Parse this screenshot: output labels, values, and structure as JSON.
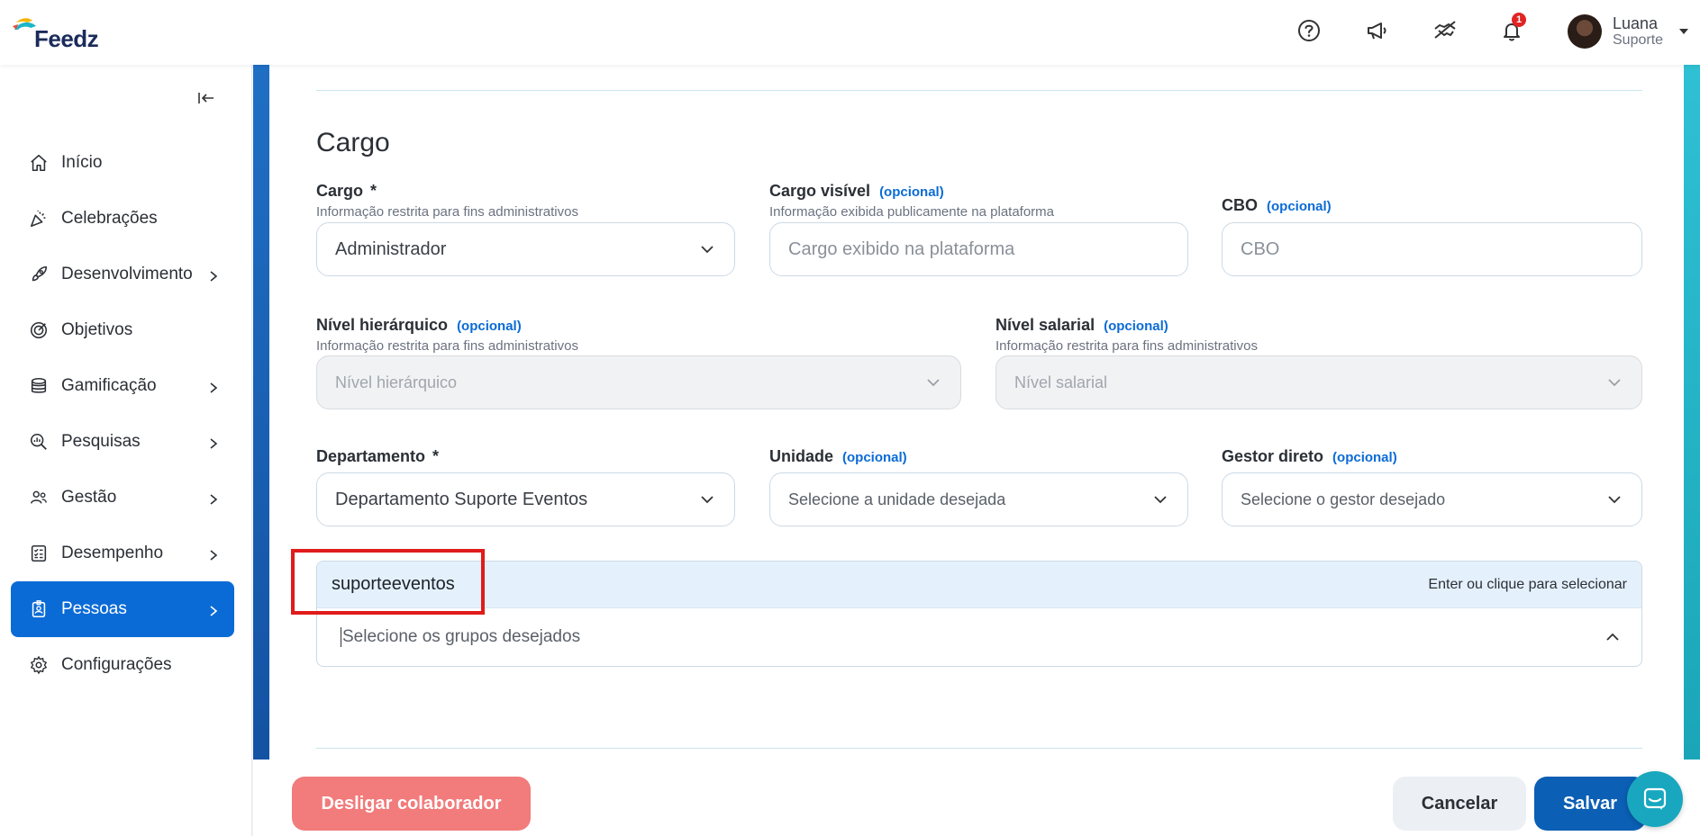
{
  "brand": {
    "name": "Feedz"
  },
  "header": {
    "icons": [
      "help-icon",
      "megaphone-icon",
      "handshake-icon",
      "bell-icon"
    ],
    "notification_count": "1",
    "user": {
      "name": "Luana",
      "role": "Suporte"
    }
  },
  "sidebar": {
    "items": [
      {
        "label": "Início",
        "icon": "home-icon",
        "has_children": false
      },
      {
        "label": "Celebrações",
        "icon": "party-icon",
        "has_children": false
      },
      {
        "label": "Desenvolvimento",
        "icon": "rocket-icon",
        "has_children": true
      },
      {
        "label": "Objetivos",
        "icon": "target-icon",
        "has_children": false
      },
      {
        "label": "Gamificação",
        "icon": "coins-icon",
        "has_children": true
      },
      {
        "label": "Pesquisas",
        "icon": "search-chart-icon",
        "has_children": true
      },
      {
        "label": "Gestão",
        "icon": "people-icon",
        "has_children": true
      },
      {
        "label": "Desempenho",
        "icon": "checklist-icon",
        "has_children": true
      },
      {
        "label": "Pessoas",
        "icon": "badge-icon",
        "has_children": true,
        "active": true
      },
      {
        "label": "Configurações",
        "icon": "gear-icon",
        "has_children": false
      }
    ]
  },
  "form": {
    "section_title": "Cargo",
    "optional_tag": "(opcional)",
    "cargo": {
      "label": "Cargo",
      "required": "*",
      "help": "Informação restrita para fins administrativos",
      "value": "Administrador"
    },
    "cargo_visivel": {
      "label": "Cargo visível",
      "help": "Informação exibida publicamente na plataforma",
      "placeholder": "Cargo exibido na plataforma"
    },
    "cbo": {
      "label": "CBO",
      "placeholder": "CBO"
    },
    "nivel_hierarquico": {
      "label": "Nível hierárquico",
      "help": "Informação restrita para fins administrativos",
      "placeholder": "Nível hierárquico"
    },
    "nivel_salarial": {
      "label": "Nível salarial",
      "help": "Informação restrita para fins administrativos",
      "placeholder": "Nível salarial"
    },
    "departamento": {
      "label": "Departamento",
      "required": "*",
      "value": "Departamento Suporte Eventos"
    },
    "unidade": {
      "label": "Unidade",
      "placeholder": "Selecione a unidade desejada"
    },
    "gestor": {
      "label": "Gestor direto",
      "placeholder": "Selecione o gestor desejado"
    },
    "grupos": {
      "option": "suporteeventos",
      "hint": "Enter ou clique para selecionar",
      "placeholder": "Selecione os grupos desejados"
    }
  },
  "footer": {
    "dismiss_label": "Desligar colaborador",
    "cancel_label": "Cancelar",
    "save_label": "Salvar"
  },
  "colors": {
    "primary": "#0b6bd6",
    "danger": "#f27b7b",
    "save": "#0b5fb4",
    "highlight": "#e01b1b",
    "chat": "#18a7bf"
  }
}
